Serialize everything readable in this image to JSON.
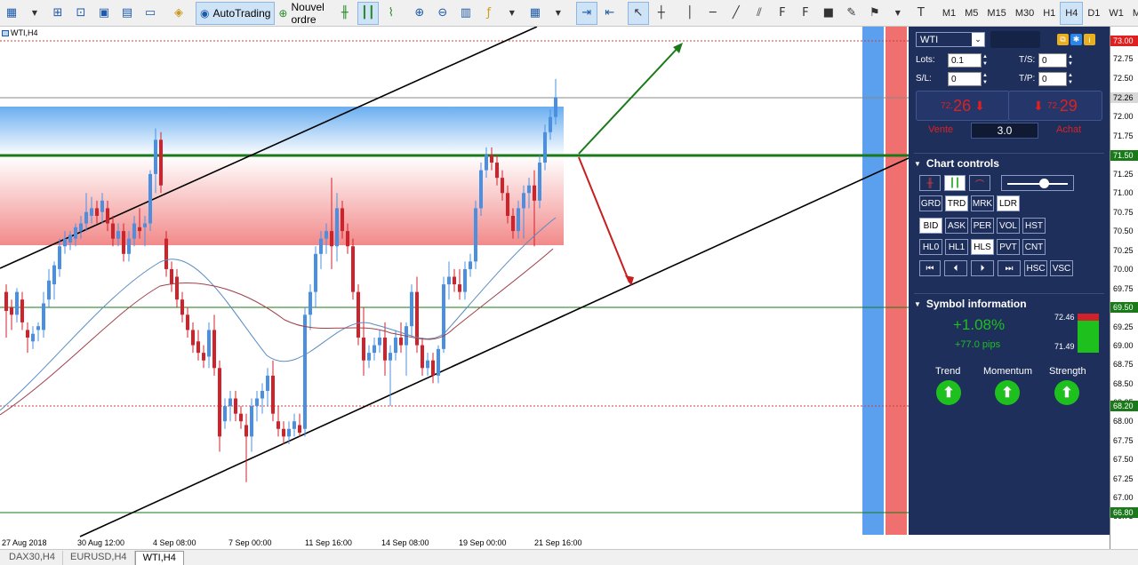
{
  "toolbar": {
    "autotrading_label": "AutoTrading",
    "new_order_label": "Nouvel ordre",
    "timeframes": [
      "M1",
      "M5",
      "M15",
      "M30",
      "H1",
      "H4",
      "D1",
      "W1",
      "MN"
    ],
    "active_timeframe": "H4"
  },
  "chart": {
    "label": "WTI,H4",
    "x_labels": [
      "27 Aug 2018",
      "30 Aug 12:00",
      "4 Sep 08:00",
      "7 Sep 00:00",
      "11 Sep 16:00",
      "14 Sep 08:00",
      "19 Sep 00:00",
      "21 Sep 16:00"
    ],
    "price_labels": [
      "72.75",
      "72.50",
      "72.00",
      "71.75",
      "71.25",
      "71.00",
      "70.75",
      "70.50",
      "70.25",
      "70.00",
      "69.75",
      "69.25",
      "69.00",
      "68.75",
      "68.50",
      "68.25",
      "68.00",
      "67.75",
      "67.50",
      "67.25",
      "67.00",
      "66.75"
    ],
    "level_badges": {
      "top": "73.00",
      "current": "72.26",
      "l1": "71.50",
      "l2": "69.50",
      "l3": "68.20",
      "l4": "66.80"
    },
    "colors": {
      "bull": "#4a90e2",
      "bear": "#d0222b",
      "level": "#1a7a1a"
    }
  },
  "panel": {
    "symbol": "WTI",
    "lots_label": "Lots:",
    "lots_value": "0.1",
    "sl_label": "S/L:",
    "sl_value": "0",
    "ts_label": "T/S:",
    "ts_value": "0",
    "tp_label": "T/P:",
    "tp_value": "0",
    "sell_small": "72.",
    "sell_big": "26",
    "sell_label": "Vente",
    "buy_small": "72.",
    "buy_big": "29",
    "buy_label": "Achat",
    "spread": "3.0",
    "chart_controls_title": "Chart controls",
    "row2": [
      "GRD",
      "TRD",
      "MRK",
      "LDR"
    ],
    "row3": [
      "BID",
      "ASK",
      "PER",
      "VOL",
      "HST"
    ],
    "row4": [
      "HL0",
      "HL1",
      "HLS",
      "PVT",
      "CNT"
    ],
    "row5": [
      "HSC",
      "VSC"
    ],
    "symbol_info_title": "Symbol information",
    "change_pct": "+1.08%",
    "change_pips": "+77.0 pips",
    "range_high": "72.46",
    "range_low": "71.49",
    "trend_label": "Trend",
    "momentum_label": "Momentum",
    "strength_label": "Strength"
  },
  "tabs": [
    "DAX30,H4",
    "EURUSD,H4",
    "WTI,H4"
  ]
}
